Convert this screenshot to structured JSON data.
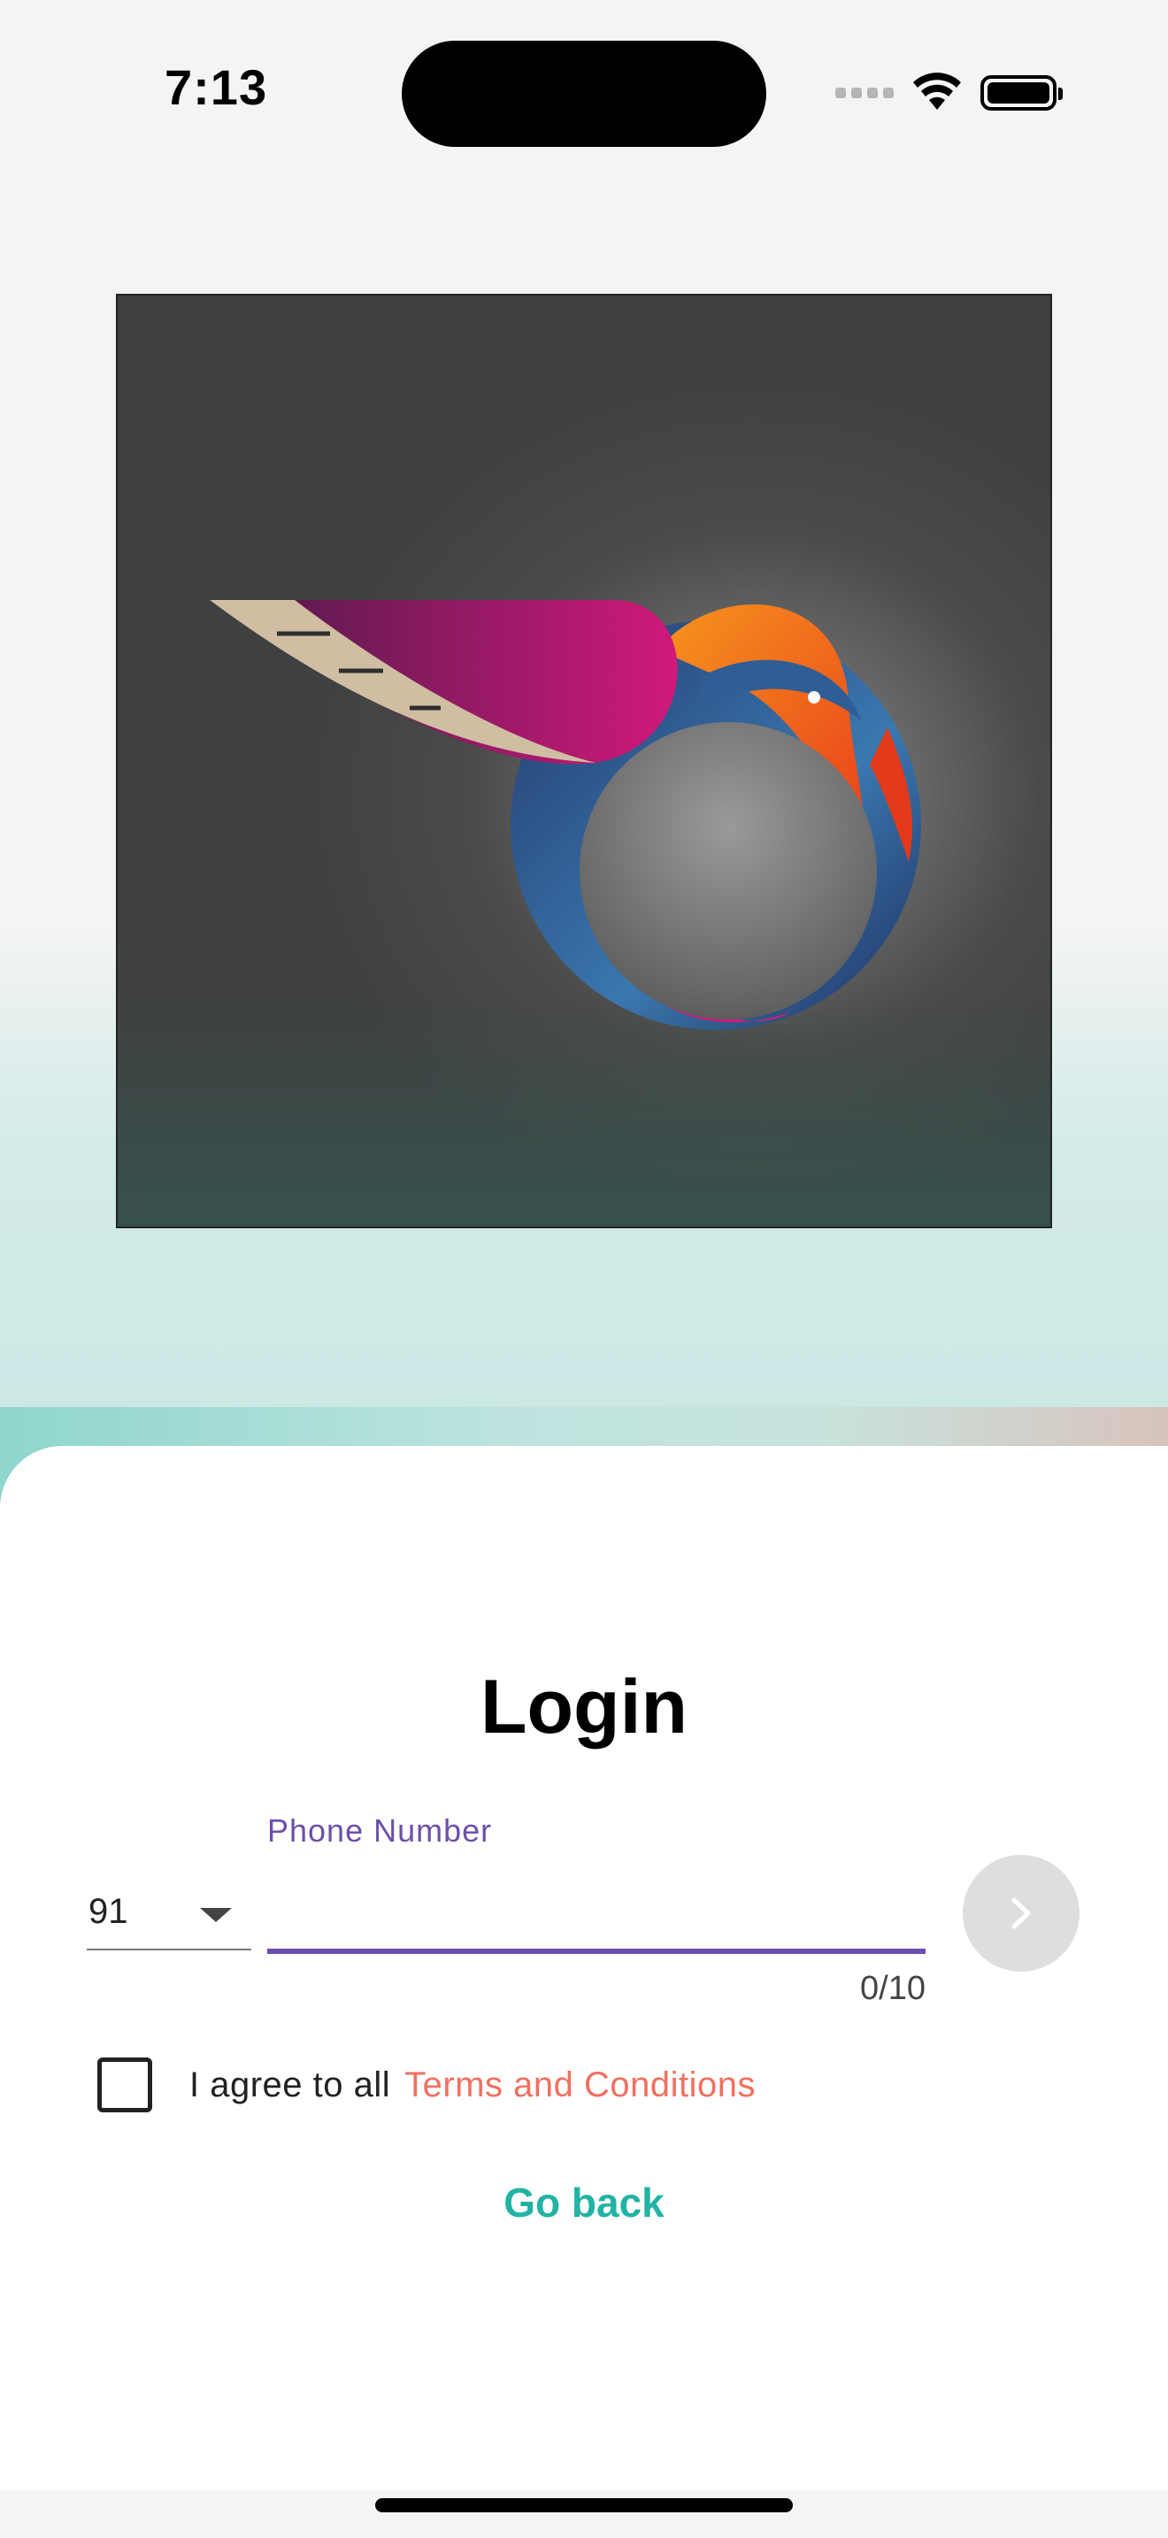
{
  "status_bar": {
    "time": "7:13"
  },
  "hero": {
    "image": "hummingbird-logo"
  },
  "login": {
    "title": "Login",
    "phone_label": "Phone Number",
    "country_code": "91",
    "phone_value": "",
    "counter": "0/10",
    "terms_prefix": "I agree to all",
    "terms_link": "Terms and Conditions",
    "go_back": "Go back"
  },
  "colors": {
    "accent_purple": "#6a4eae",
    "terms_link": "#f07060",
    "go_back": "#22b3a4"
  }
}
